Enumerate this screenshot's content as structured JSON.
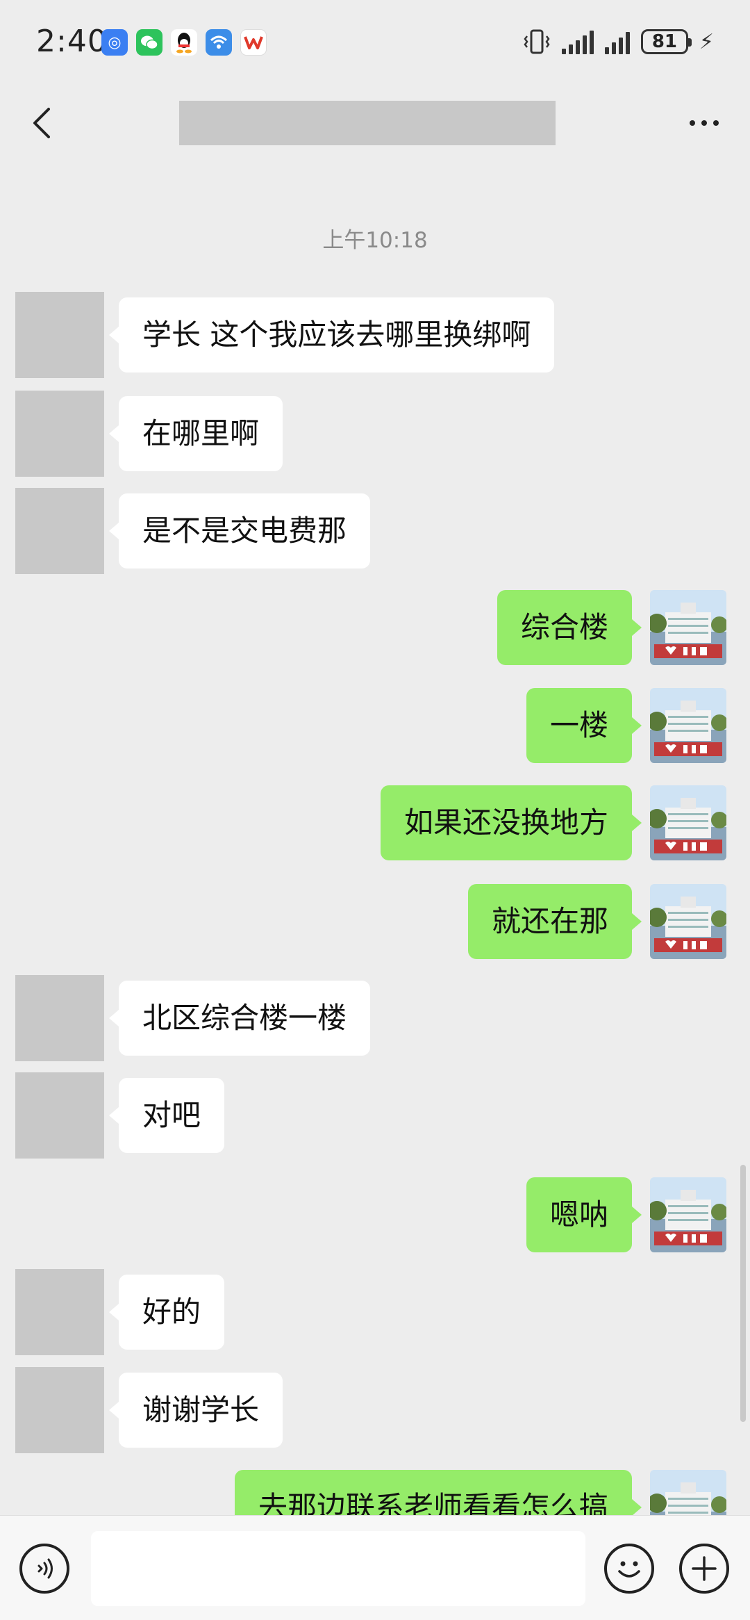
{
  "status_bar": {
    "time": "2:40",
    "battery": "81",
    "notification_icons": [
      "app-icon",
      "wechat-icon",
      "qq-icon",
      "wifi-app-icon",
      "wps-icon"
    ]
  },
  "header": {
    "title": ""
  },
  "chat": {
    "timestamp": "上午10:18",
    "messages": [
      {
        "from": "them",
        "text": "学长 这个我应该去哪里换绑啊"
      },
      {
        "from": "them",
        "text": "在哪里啊"
      },
      {
        "from": "them",
        "text": "是不是交电费那"
      },
      {
        "from": "me",
        "text": "综合楼"
      },
      {
        "from": "me",
        "text": "一楼"
      },
      {
        "from": "me",
        "text": "如果还没换地方"
      },
      {
        "from": "me",
        "text": "就还在那"
      },
      {
        "from": "them",
        "text": "北区综合楼一楼"
      },
      {
        "from": "them",
        "text": "对吧"
      },
      {
        "from": "me",
        "text": "嗯呐"
      },
      {
        "from": "them",
        "text": "好的"
      },
      {
        "from": "them",
        "text": "谢谢学长"
      },
      {
        "from": "me",
        "text": "去那边联系老师看看怎么搞"
      }
    ]
  },
  "input_bar": {
    "input_value": ""
  },
  "colors": {
    "background": "#ededed",
    "my_bubble": "#95ec69",
    "their_bubble": "#ffffff"
  }
}
